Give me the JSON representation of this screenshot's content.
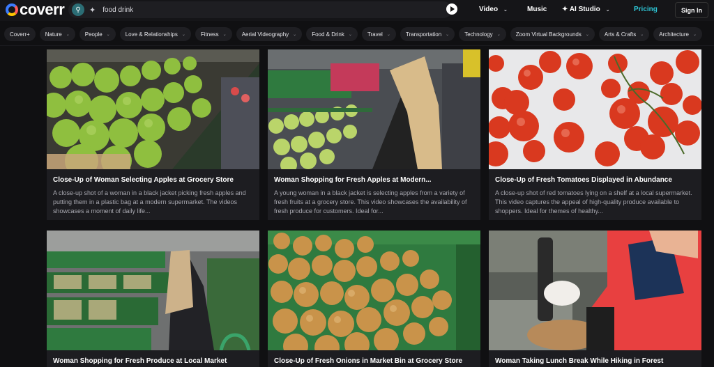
{
  "header": {
    "logo_text": "coverr",
    "search": {
      "value": "food drink",
      "placeholder": ""
    },
    "nav": [
      {
        "label": "Video"
      },
      {
        "label": "Music"
      },
      {
        "label": "AI Studio"
      }
    ],
    "pricing_label": "Pricing",
    "signin_label": "Sign In"
  },
  "categories": [
    "Coverr+",
    "Nature",
    "People",
    "Love & Relationships",
    "Fitness",
    "Aerial Videography",
    "Food & Drink",
    "Travel",
    "Transportation",
    "Technology",
    "Zoom Virtual Backgrounds",
    "Arts & Crafts",
    "Architecture"
  ],
  "videos": [
    {
      "title": "Close-Up of Woman Selecting Apples at Grocery Store",
      "description": "A close-up shot of a woman in a black jacket picking fresh apples and putting them in a plastic bag at a modern supermarket. The videos showcases a moment of daily life..."
    },
    {
      "title": "Woman Shopping for Fresh Apples at Modern...",
      "description": "A young woman in a black jacket is selecting apples from a variety of fresh fruits at a grocery store. This video showcases the availability of fresh produce for customers. Ideal for..."
    },
    {
      "title": "Close-Up of Fresh Tomatoes Displayed in Abundance",
      "description": "A close-up shot of red tomatoes lying on a shelf at a local supermarket. This video captures the appeal of high-quality produce available to shoppers. Ideal for themes of healthy..."
    },
    {
      "title": "Woman Shopping for Fresh Produce at Local Market",
      "description": ""
    },
    {
      "title": "Close-Up of Fresh Onions in Market Bin at Grocery Store",
      "description": ""
    },
    {
      "title": "Woman Taking Lunch Break While Hiking in Forest",
      "description": ""
    }
  ]
}
